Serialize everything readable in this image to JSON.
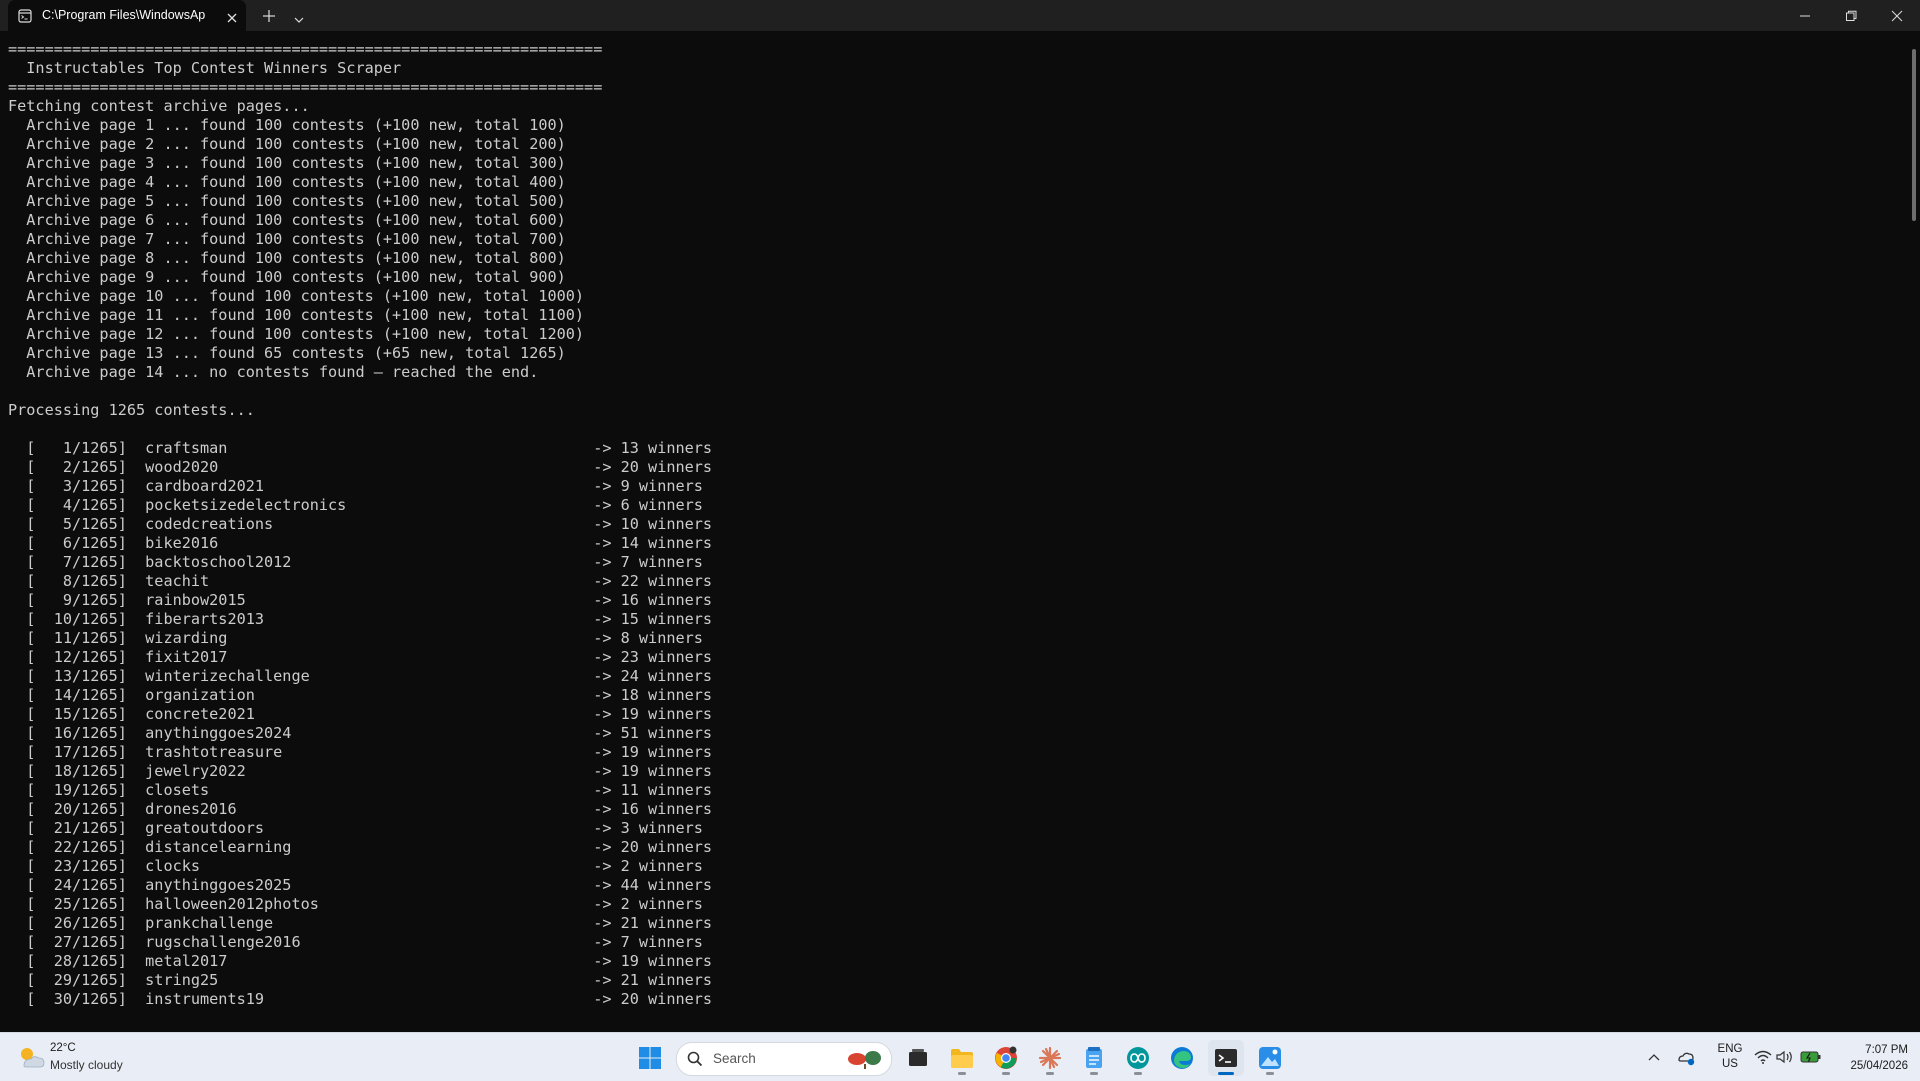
{
  "window": {
    "tab_title": "C:\\Program Files\\WindowsAp"
  },
  "terminal": {
    "lines": [
      "=================================================================",
      "  Instructables Top Contest Winners Scraper",
      "=================================================================",
      "Fetching contest archive pages...",
      "  Archive page 1 ... found 100 contests (+100 new, total 100)",
      "  Archive page 2 ... found 100 contests (+100 new, total 200)",
      "  Archive page 3 ... found 100 contests (+100 new, total 300)",
      "  Archive page 4 ... found 100 contests (+100 new, total 400)",
      "  Archive page 5 ... found 100 contests (+100 new, total 500)",
      "  Archive page 6 ... found 100 contests (+100 new, total 600)",
      "  Archive page 7 ... found 100 contests (+100 new, total 700)",
      "  Archive page 8 ... found 100 contests (+100 new, total 800)",
      "  Archive page 9 ... found 100 contests (+100 new, total 900)",
      "  Archive page 10 ... found 100 contests (+100 new, total 1000)",
      "  Archive page 11 ... found 100 contests (+100 new, total 1100)",
      "  Archive page 12 ... found 100 contests (+100 new, total 1200)",
      "  Archive page 13 ... found 65 contests (+65 new, total 1265)",
      "  Archive page 14 ... no contests found – reached the end.",
      "",
      "Processing 1265 contests...",
      "",
      "  [   1/1265]  craftsman                                        -> 13 winners",
      "  [   2/1265]  wood2020                                         -> 20 winners",
      "  [   3/1265]  cardboard2021                                    -> 9 winners",
      "  [   4/1265]  pocketsizedelectronics                           -> 6 winners",
      "  [   5/1265]  codedcreations                                   -> 10 winners",
      "  [   6/1265]  bike2016                                         -> 14 winners",
      "  [   7/1265]  backtoschool2012                                 -> 7 winners",
      "  [   8/1265]  teachit                                          -> 22 winners",
      "  [   9/1265]  rainbow2015                                      -> 16 winners",
      "  [  10/1265]  fiberarts2013                                    -> 15 winners",
      "  [  11/1265]  wizarding                                        -> 8 winners",
      "  [  12/1265]  fixit2017                                        -> 23 winners",
      "  [  13/1265]  winterizechallenge                               -> 24 winners",
      "  [  14/1265]  organization                                     -> 18 winners",
      "  [  15/1265]  concrete2021                                     -> 19 winners",
      "  [  16/1265]  anythinggoes2024                                 -> 51 winners",
      "  [  17/1265]  trashtotreasure                                  -> 19 winners",
      "  [  18/1265]  jewelry2022                                      -> 19 winners",
      "  [  19/1265]  closets                                          -> 11 winners",
      "  [  20/1265]  drones2016                                       -> 16 winners",
      "  [  21/1265]  greatoutdoors                                    -> 3 winners",
      "  [  22/1265]  distancelearning                                 -> 20 winners",
      "  [  23/1265]  clocks                                           -> 2 winners",
      "  [  24/1265]  anythinggoes2025                                 -> 44 winners",
      "  [  25/1265]  halloween2012photos                              -> 2 winners",
      "  [  26/1265]  prankchallenge                                   -> 21 winners",
      "  [  27/1265]  rugschallenge2016                                -> 7 winners",
      "  [  28/1265]  metal2017                                        -> 19 winners",
      "  [  29/1265]  string25                                         -> 21 winners",
      "  [  30/1265]  instruments19                                    -> 20 winners"
    ]
  },
  "taskbar": {
    "weather_temp": "22°C",
    "weather_condition": "Mostly cloudy",
    "search_placeholder": "Search",
    "language": "ENG",
    "region": "US",
    "time": "7:07 PM",
    "date": "25/04/2026",
    "accent_color": "#0067c0",
    "terminal_bg": "#0c0c0c"
  }
}
